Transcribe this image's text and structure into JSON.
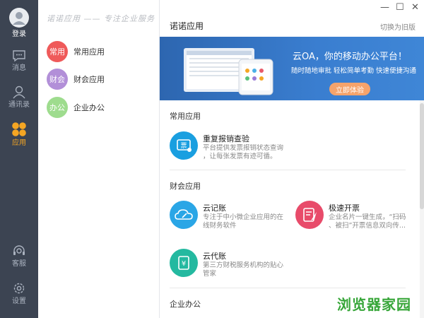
{
  "rail": {
    "login": "登录",
    "messages": "消息",
    "contacts": "通讯录",
    "apps": "应用",
    "service": "客服",
    "settings": "设置"
  },
  "middle": {
    "slogan": "诺诺应用 —— 专注企业服务",
    "categories": [
      {
        "badge": "常用",
        "name": "常用应用",
        "color": "#ef5a5a"
      },
      {
        "badge": "财会",
        "name": "财会应用",
        "color": "#b28fd8"
      },
      {
        "badge": "办公",
        "name": "企业办公",
        "color": "#9edc8e"
      }
    ]
  },
  "main": {
    "title": "诺诺应用",
    "switch": "切换为旧版",
    "window": {
      "min": "—",
      "max": "☐",
      "close": "✕"
    },
    "banner": {
      "headline": "云OA，你的移动办公平台！",
      "sub": "随时随地审批  轻松简单考勤  快速便捷沟通",
      "button": "立即体验"
    },
    "sections": [
      {
        "title": "常用应用",
        "cards": [
          {
            "title": "重复报销查验",
            "desc": [
              "平台提供发票报销状态查询",
              "，让每张发票有迹可循。"
            ],
            "color": "#1a9fe0",
            "icon": "invoice-icon"
          }
        ]
      },
      {
        "title": "财会应用",
        "cards": [
          {
            "title": "云记账",
            "desc": [
              "专注于中小微企业应用的在",
              "线财务软件"
            ],
            "color": "#2aa6e6",
            "icon": "cloud-pen-icon"
          },
          {
            "title": "极速开票",
            "desc": [
              "企业名片一键生成，“扫码",
              "、被扫”开票信息双向传..."
            ],
            "color": "#e84b6a",
            "icon": "rocket-icon"
          },
          {
            "title": "云代账",
            "desc": [
              "第三方财税服务机构的贴心",
              "管家"
            ],
            "color": "#24b9a0",
            "icon": "ledger-icon"
          }
        ]
      },
      {
        "title": "企业办公",
        "cards": []
      }
    ]
  },
  "watermark": "浏览器家园"
}
